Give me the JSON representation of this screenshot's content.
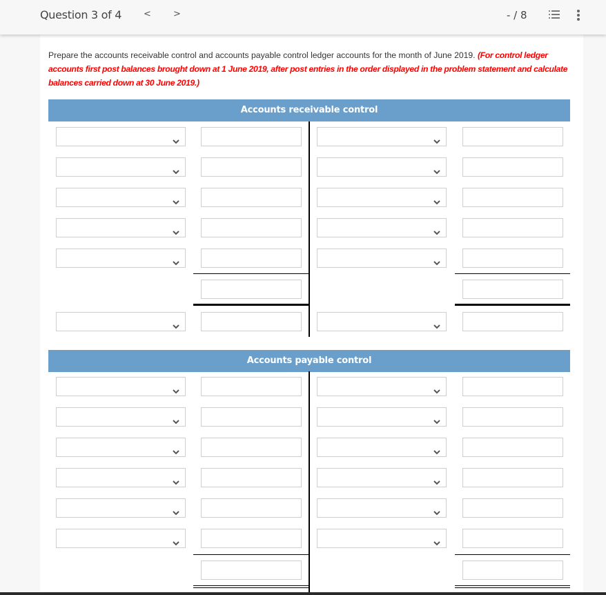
{
  "header": {
    "question_label": "Question 3 of 4",
    "prev_icon": "chevron-left-icon",
    "prev_glyph": "<",
    "next_icon": "chevron-right-icon",
    "next_glyph": ">",
    "score": "- / 8",
    "question_list_icon": "numbered-list-icon",
    "more_icon": "more-vertical-icon"
  },
  "instructions": {
    "text": "Prepare the accounts receivable control and accounts payable control ledger accounts for the month of June 2019.",
    "note": "(For control ledger accounts first post balances brought down at 1 June 2019, after post entries in the order displayed in the problem statement and calculate balances carried down at 30 June 2019.)"
  },
  "ledgers": [
    {
      "title": "Accounts receivable control",
      "debit_rows": [
        {
          "account": "",
          "amount": ""
        },
        {
          "account": "",
          "amount": ""
        },
        {
          "account": "",
          "amount": ""
        },
        {
          "account": "",
          "amount": ""
        },
        {
          "account": "",
          "amount": ""
        }
      ],
      "credit_rows": [
        {
          "account": "",
          "amount": ""
        },
        {
          "account": "",
          "amount": ""
        },
        {
          "account": "",
          "amount": ""
        },
        {
          "account": "",
          "amount": ""
        },
        {
          "account": "",
          "amount": ""
        }
      ],
      "debit_total": "",
      "credit_total": "",
      "balance_row": {
        "debit_account": "",
        "debit_amount": "",
        "credit_account": "",
        "credit_amount": ""
      }
    },
    {
      "title": "Accounts payable control",
      "debit_rows": [
        {
          "account": "",
          "amount": ""
        },
        {
          "account": "",
          "amount": ""
        },
        {
          "account": "",
          "amount": ""
        },
        {
          "account": "",
          "amount": ""
        },
        {
          "account": "",
          "amount": ""
        },
        {
          "account": "",
          "amount": ""
        }
      ],
      "credit_rows": [
        {
          "account": "",
          "amount": ""
        },
        {
          "account": "",
          "amount": ""
        },
        {
          "account": "",
          "amount": ""
        },
        {
          "account": "",
          "amount": ""
        },
        {
          "account": "",
          "amount": ""
        },
        {
          "account": "",
          "amount": ""
        }
      ],
      "debit_total": "",
      "credit_total": ""
    }
  ],
  "select_icon": "chevron-down-icon"
}
